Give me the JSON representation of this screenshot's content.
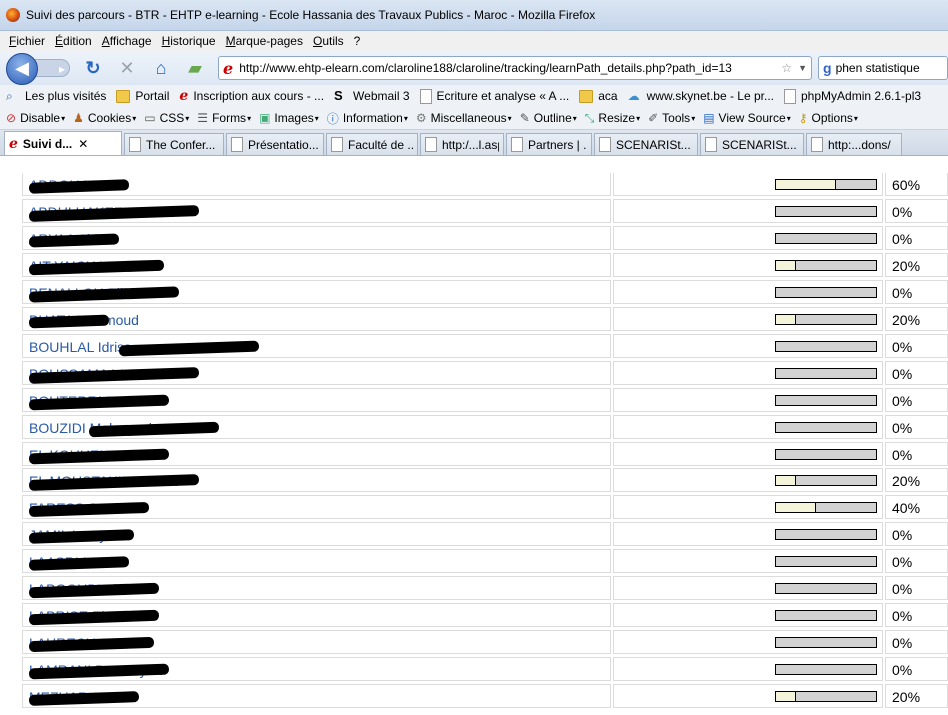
{
  "window": {
    "title": "Suivi des parcours - BTR - EHTP e-learning - Ecole Hassania des Travaux Publics - Maroc - Mozilla Firefox"
  },
  "menu": [
    "Fichier",
    "Édition",
    "Affichage",
    "Historique",
    "Marque-pages",
    "Outils",
    "?"
  ],
  "nav": {
    "url": "http://www.ehtp-elearn.com/claroline188/claroline/tracking/learnPath_details.php?path_id=13",
    "search_value": "phen statistique"
  },
  "bookmarks": [
    {
      "label": "Les plus visités",
      "icon": "search-page-icon"
    },
    {
      "label": "Portail",
      "icon": "folder-icon"
    },
    {
      "label": "Inscription aux cours - ...",
      "icon": "e-icon"
    },
    {
      "label": "Webmail 3",
      "icon": "s-icon"
    },
    {
      "label": "Ecriture et analyse « A ...",
      "icon": "page-icon"
    },
    {
      "label": "aca",
      "icon": "folder-icon"
    },
    {
      "label": "www.skynet.be - Le pr...",
      "icon": "cloud-icon"
    },
    {
      "label": "phpMyAdmin 2.6.1-pl3",
      "icon": "page-icon"
    }
  ],
  "devtools": [
    "Disable",
    "Cookies",
    "CSS",
    "Forms",
    "Images",
    "Information",
    "Miscellaneous",
    "Outline",
    "Resize",
    "Tools",
    "View Source",
    "Options"
  ],
  "tabs": [
    {
      "label": "Suivi d...",
      "active": true
    },
    {
      "label": "The Confer...",
      "active": false
    },
    {
      "label": "Présentatio...",
      "active": false
    },
    {
      "label": "Faculté de ...",
      "active": false
    },
    {
      "label": "http:/...l.aspx",
      "active": false
    },
    {
      "label": "Partners | ...",
      "active": false
    },
    {
      "label": "SCENARISt...",
      "active": false
    },
    {
      "label": "SCENARISt...",
      "active": false
    },
    {
      "label": "http:...dons/",
      "active": false
    }
  ],
  "rows": [
    {
      "name": "ADDOU Nadir",
      "progress": 0.6,
      "label": "60%"
    },
    {
      "name": "ABDULHAKEEM Yassir",
      "progress": 0,
      "label": "0%"
    },
    {
      "name": "ARYAA Abir",
      "progress": 0,
      "label": "0%"
    },
    {
      "name": "AIT YAICH Youssef",
      "progress": 0.2,
      "label": "20%"
    },
    {
      "name": "BENALLOU Bilal",
      "progress": 0,
      "label": "0%"
    },
    {
      "name": "BHATA Mahmoud",
      "progress": 0.2,
      "label": "20%"
    },
    {
      "name": "BOUHLAL Idriss",
      "progress": 0,
      "label": "0%"
    },
    {
      "name": "BOUSSAMAA Youssef",
      "progress": 0,
      "label": "0%"
    },
    {
      "name": "BOUTERFAS Sara",
      "progress": 0,
      "label": "0%"
    },
    {
      "name": "BOUZIDI Mohamed",
      "progress": 0,
      "label": "0%"
    },
    {
      "name": "EL KOUHEN Sarah",
      "progress": 0,
      "label": "0%"
    },
    {
      "name": "EL MOUSTAKIM Zainab",
      "progress": 0.2,
      "label": "20%"
    },
    {
      "name": "FARESS Sarah",
      "progress": 0.4,
      "label": "40%"
    },
    {
      "name": "JAMIL Lamyae",
      "progress": 0,
      "label": "0%"
    },
    {
      "name": "LAASRI Imane",
      "progress": 0,
      "label": "0%"
    },
    {
      "name": "LABGOUBI Khalid",
      "progress": 0,
      "label": "0%"
    },
    {
      "name": "LABRISE El Mehdi",
      "progress": 0,
      "label": "0%"
    },
    {
      "name": "LAHRECH Sarah",
      "progress": 0,
      "label": "0%"
    },
    {
      "name": "LAMRANI Bouthayna",
      "progress": 0,
      "label": "0%"
    },
    {
      "name": "MEZHAR Assia",
      "progress": 0.2,
      "label": "20%"
    }
  ]
}
